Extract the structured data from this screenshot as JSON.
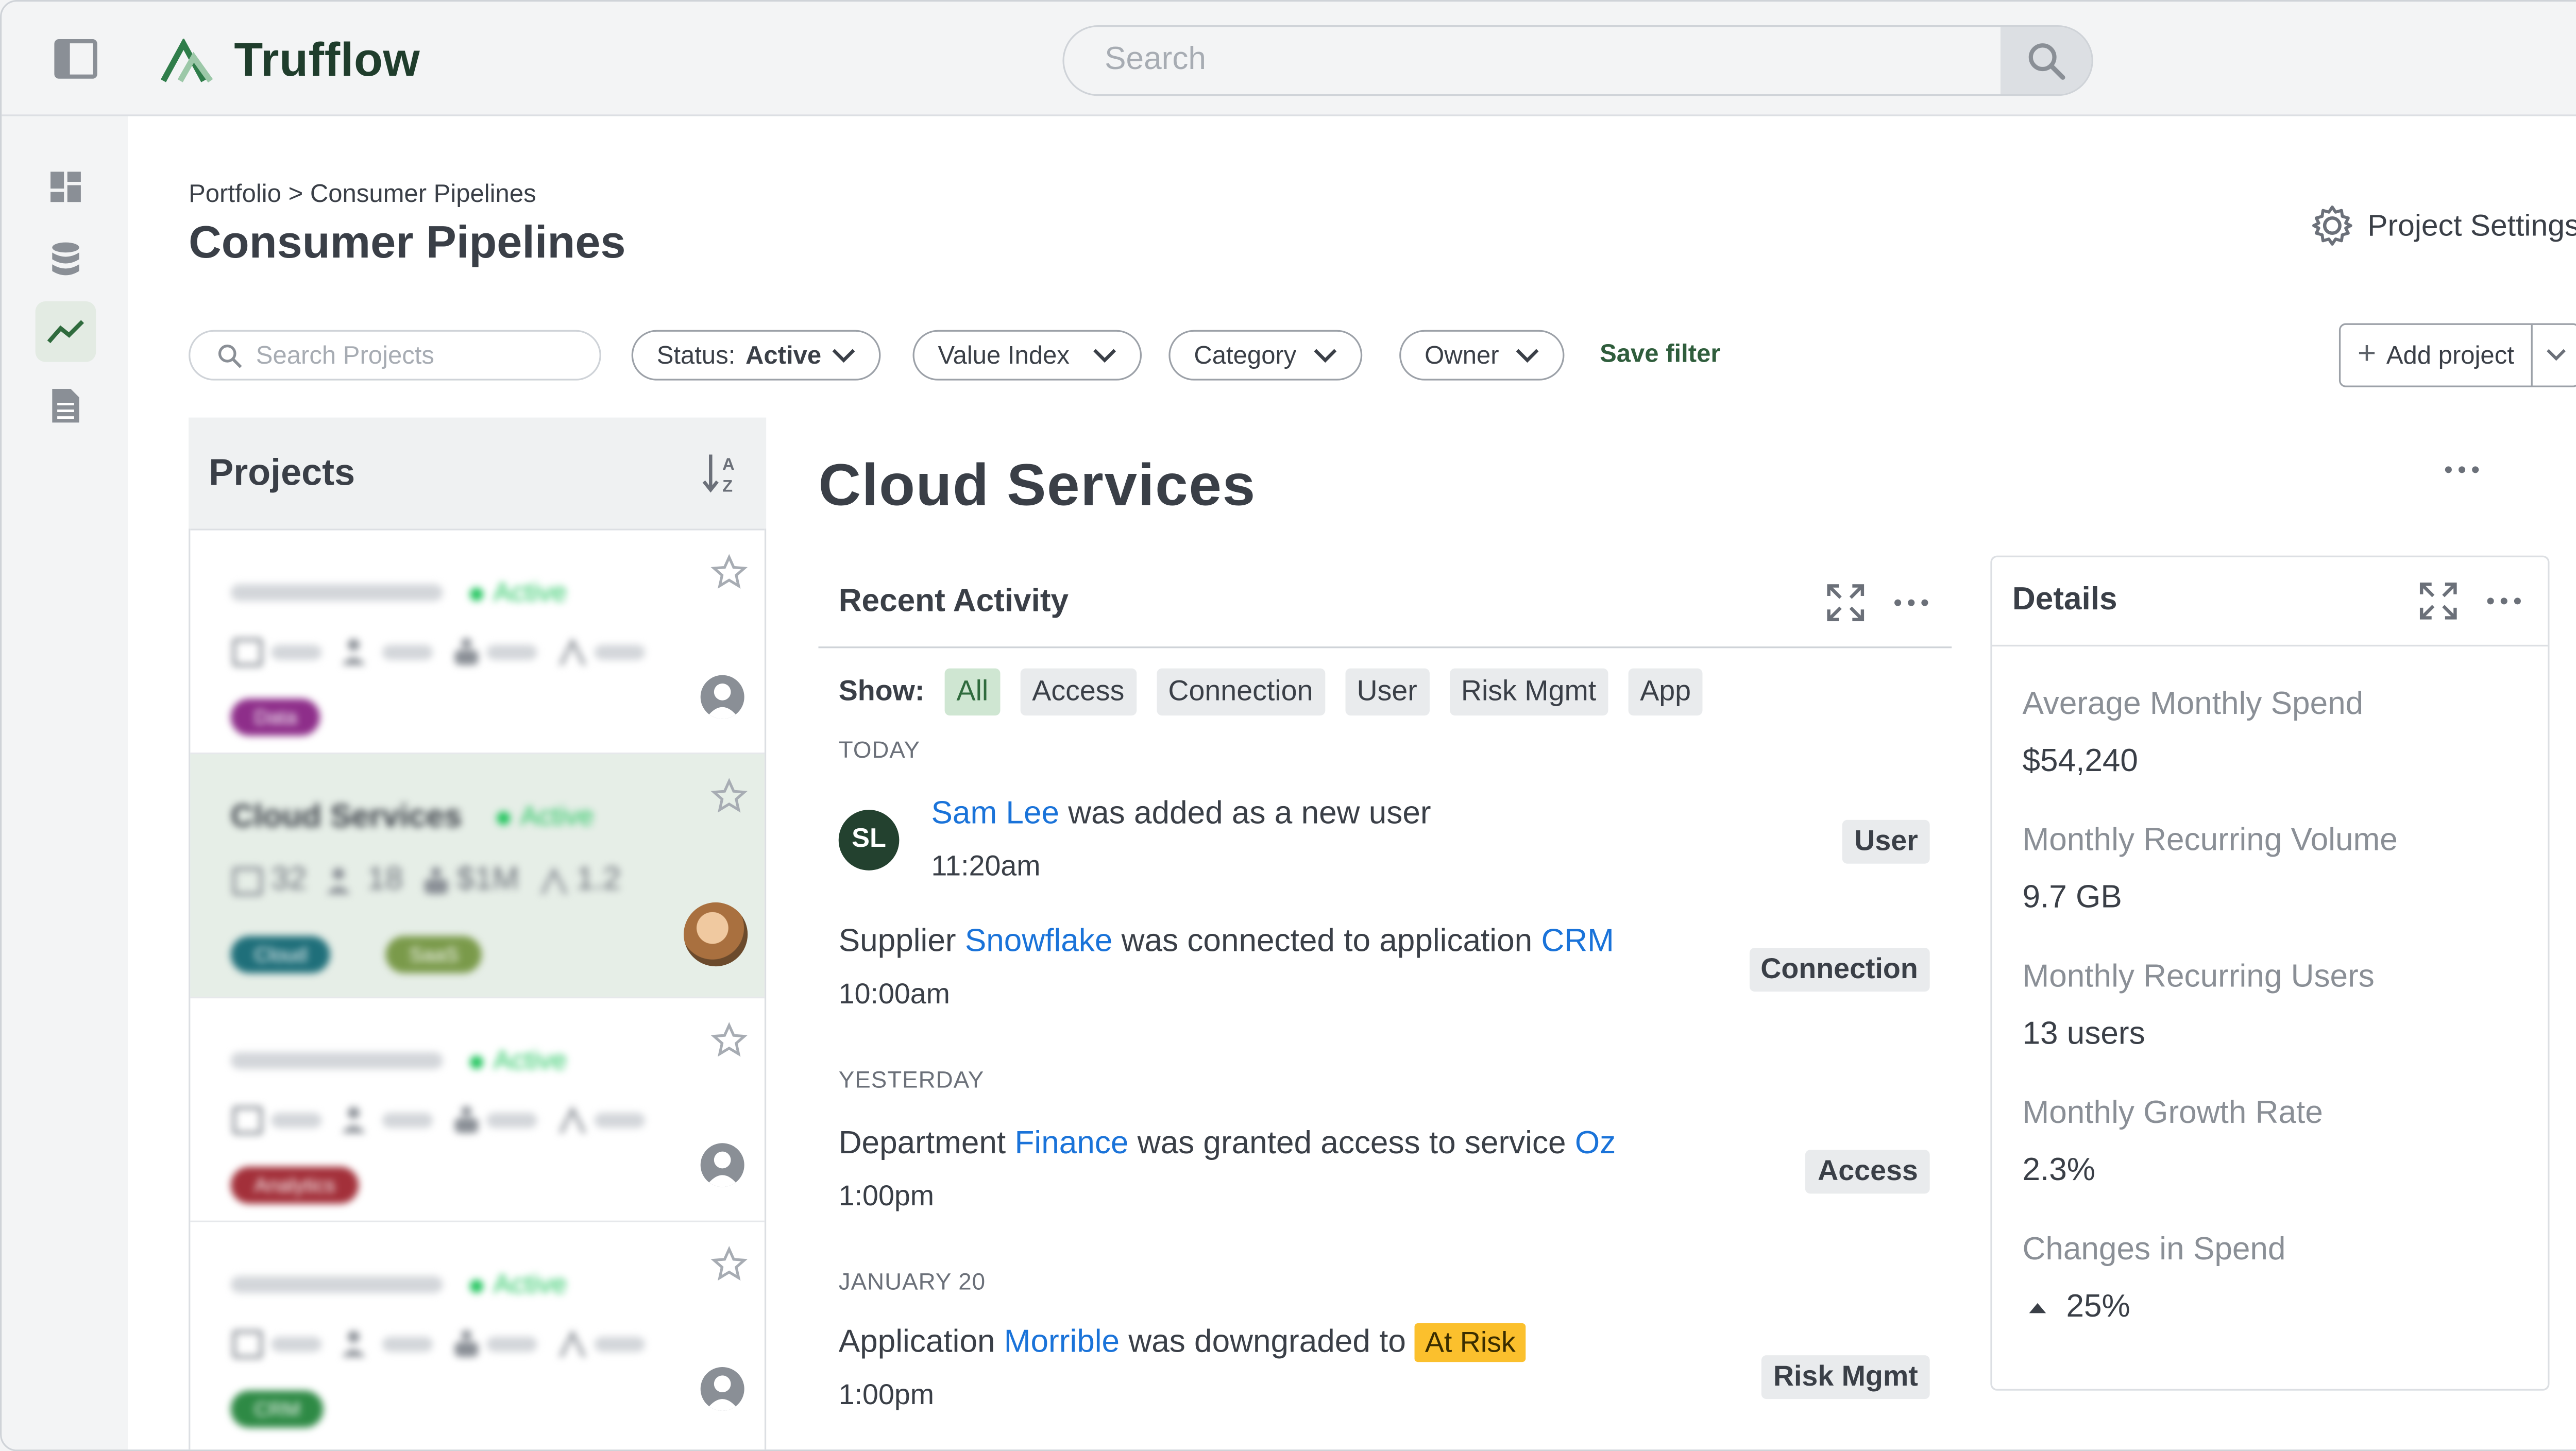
{
  "app": {
    "name": "Trufflow"
  },
  "search": {
    "placeholder": "Search"
  },
  "breadcrumb": {
    "root": "Portfolio",
    "separator": ">",
    "current": "Consumer Pipelines"
  },
  "page": {
    "title": "Consumer Pipelines",
    "settings_label": "Project Settings"
  },
  "filters": {
    "search_placeholder": "Search Projects",
    "status_label": "Status:",
    "status_value": "Active",
    "value_index": "Value Index",
    "category": "Category",
    "owner": "Owner",
    "save_filter": "Save filter",
    "add_project": "Add project"
  },
  "projects": {
    "title": "Projects",
    "cards": [
      {
        "status": "Active",
        "tag": "Data",
        "tag_color": "#8e2e8a"
      },
      {
        "name": "Cloud Services",
        "status": "Active",
        "tasks": "32",
        "users": "18",
        "value": "$1M",
        "index": "1.2",
        "tags": [
          {
            "label": "Cloud",
            "color": "#1f6f7a"
          },
          {
            "label": "SaaS",
            "color": "#7a9a4a"
          }
        ]
      },
      {
        "status": "Active",
        "tag": "Analytics",
        "tag_color": "#a3303a"
      },
      {
        "status": "Active",
        "tag": "CRM",
        "tag_color": "#2e8a45"
      }
    ]
  },
  "detail": {
    "title": "Cloud Services"
  },
  "activity": {
    "title": "Recent Activity",
    "show_label": "Show:",
    "filters": [
      "All",
      "Access",
      "Connection",
      "User",
      "Risk Mgmt",
      "App"
    ],
    "sections": {
      "today": "TODAY",
      "yesterday": "YESTERDAY",
      "jan20": "JANUARY 20"
    },
    "events": [
      {
        "avatar": "SL",
        "actor": "Sam Lee",
        "text": "was added as a new user",
        "time": "11:20am",
        "tag": "User"
      },
      {
        "pre": "Supplier",
        "link1": "Snowflake",
        "mid": "was connected to application",
        "link2": "CRM",
        "time": "10:00am",
        "tag": "Connection"
      },
      {
        "pre": "Department",
        "link1": "Finance",
        "mid": "was granted access to service",
        "link2": "Oz",
        "time": "1:00pm",
        "tag": "Access"
      },
      {
        "pre": "Application",
        "link1": "Morrible",
        "mid": "was downgraded to",
        "badge": "At Risk",
        "time": "1:00pm",
        "tag": "Risk Mgmt"
      }
    ]
  },
  "details": {
    "title": "Details",
    "items": [
      {
        "label": "Average Monthly Spend",
        "value": "$54,240"
      },
      {
        "label": "Monthly Recurring Volume",
        "value": "9.7 GB"
      },
      {
        "label": "Monthly Recurring Users",
        "value": "13 users"
      },
      {
        "label": "Monthly Growth Rate",
        "value": "2.3%"
      },
      {
        "label": "Changes in Spend",
        "value": "25%"
      }
    ]
  },
  "colors": {
    "brand": "#1f3d2c",
    "accent": "#2f5d3c",
    "link": "#1a73d9",
    "active_status": "#22c55e",
    "risk": "#fbc02d"
  },
  "icons": [
    "sidebar-toggle-icon",
    "search-icon",
    "dashboard-icon",
    "database-icon",
    "trend-icon",
    "document-icon",
    "gear-icon",
    "sort-az-icon",
    "star-icon",
    "expand-icon",
    "more-icon",
    "chevron-down-icon",
    "caret-up-icon"
  ]
}
